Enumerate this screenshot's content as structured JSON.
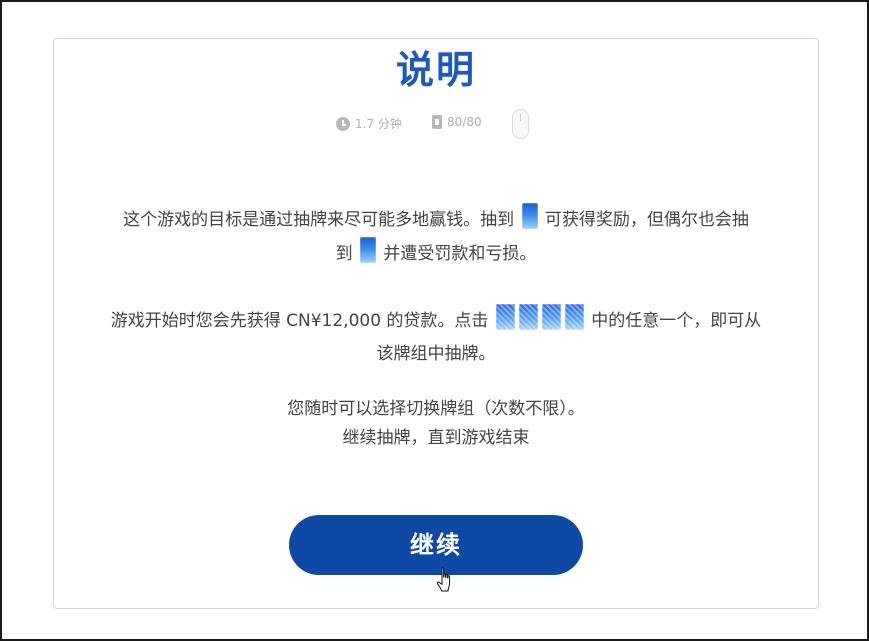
{
  "title": "说明",
  "meta": {
    "time_label": "1.7 分钟",
    "cards_label": "80/80",
    "icons": [
      "clock-icon",
      "card-count-icon",
      "mouse-icon"
    ]
  },
  "instructions": {
    "p1_a": "这个游戏的目标是通过抽牌来尽可能多地赢钱。抽到",
    "p1_b": "可获得奖励，但偶尔也会抽",
    "p1_c": "到",
    "p1_d": "并遭受罚款和亏损。",
    "p2_a": "游戏开始时您会先获得 CN¥12,000 的贷款。点击",
    "p2_b": "中的任意一个，即可从",
    "p2_c": "该牌组中抽牌。",
    "p3_a": "您随时可以选择切换牌组（次数不限）。",
    "p3_b": "继续抽牌，直到游戏结束"
  },
  "continue_button": {
    "label": "继续"
  },
  "colors": {
    "title": "#1b5bbf",
    "button": "#0e4aa5",
    "card_top": "#1f5fd0",
    "card_bottom": "#9fd0ff"
  }
}
